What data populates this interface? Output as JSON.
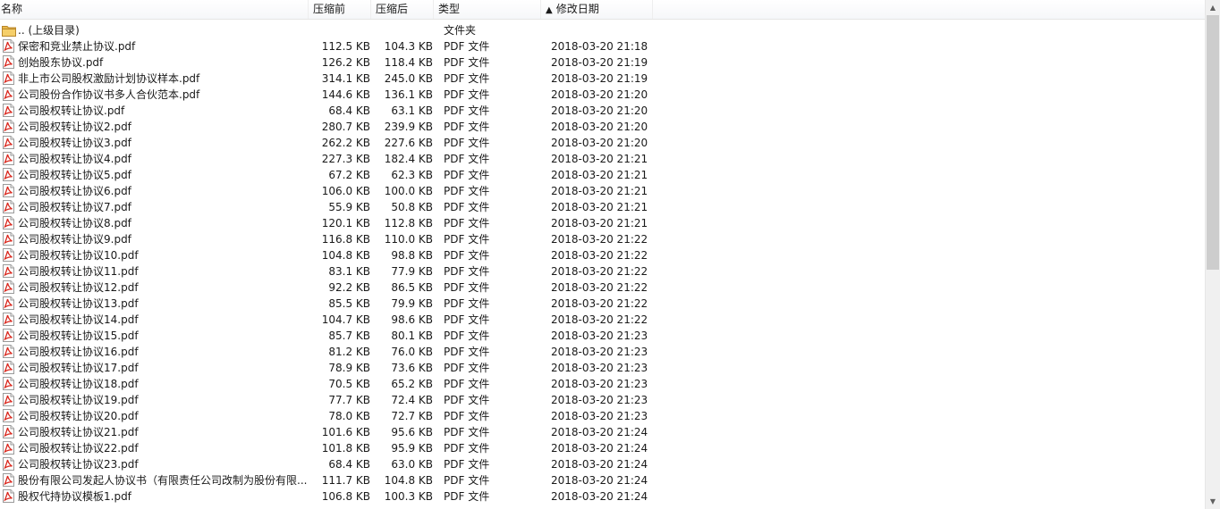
{
  "columns": {
    "name": "名称",
    "size_before": "压缩前",
    "size_after": "压缩后",
    "type": "类型",
    "modified": "修改日期",
    "sort_indicator": "▲"
  },
  "parent_row": {
    "name": ".. (上级目录)",
    "type": "文件夹",
    "icon": "folder-icon"
  },
  "files": [
    {
      "name": "保密和竞业禁止协议.pdf",
      "before": "112.5 KB",
      "after": "104.3 KB",
      "type": "PDF 文件",
      "date": "2018-03-20 21:18"
    },
    {
      "name": "创始股东协议.pdf",
      "before": "126.2 KB",
      "after": "118.4 KB",
      "type": "PDF 文件",
      "date": "2018-03-20 21:19"
    },
    {
      "name": "非上市公司股权激励计划协议样本.pdf",
      "before": "314.1 KB",
      "after": "245.0 KB",
      "type": "PDF 文件",
      "date": "2018-03-20 21:19"
    },
    {
      "name": "公司股份合作协议书多人合伙范本.pdf",
      "before": "144.6 KB",
      "after": "136.1 KB",
      "type": "PDF 文件",
      "date": "2018-03-20 21:20"
    },
    {
      "name": "公司股权转让协议.pdf",
      "before": "68.4 KB",
      "after": "63.1 KB",
      "type": "PDF 文件",
      "date": "2018-03-20 21:20"
    },
    {
      "name": "公司股权转让协议2.pdf",
      "before": "280.7 KB",
      "after": "239.9 KB",
      "type": "PDF 文件",
      "date": "2018-03-20 21:20"
    },
    {
      "name": "公司股权转让协议3.pdf",
      "before": "262.2 KB",
      "after": "227.6 KB",
      "type": "PDF 文件",
      "date": "2018-03-20 21:20"
    },
    {
      "name": "公司股权转让协议4.pdf",
      "before": "227.3 KB",
      "after": "182.4 KB",
      "type": "PDF 文件",
      "date": "2018-03-20 21:21"
    },
    {
      "name": "公司股权转让协议5.pdf",
      "before": "67.2 KB",
      "after": "62.3 KB",
      "type": "PDF 文件",
      "date": "2018-03-20 21:21"
    },
    {
      "name": "公司股权转让协议6.pdf",
      "before": "106.0 KB",
      "after": "100.0 KB",
      "type": "PDF 文件",
      "date": "2018-03-20 21:21"
    },
    {
      "name": "公司股权转让协议7.pdf",
      "before": "55.9 KB",
      "after": "50.8 KB",
      "type": "PDF 文件",
      "date": "2018-03-20 21:21"
    },
    {
      "name": "公司股权转让协议8.pdf",
      "before": "120.1 KB",
      "after": "112.8 KB",
      "type": "PDF 文件",
      "date": "2018-03-20 21:21"
    },
    {
      "name": "公司股权转让协议9.pdf",
      "before": "116.8 KB",
      "after": "110.0 KB",
      "type": "PDF 文件",
      "date": "2018-03-20 21:22"
    },
    {
      "name": "公司股权转让协议10.pdf",
      "before": "104.8 KB",
      "after": "98.8 KB",
      "type": "PDF 文件",
      "date": "2018-03-20 21:22"
    },
    {
      "name": "公司股权转让协议11.pdf",
      "before": "83.1 KB",
      "after": "77.9 KB",
      "type": "PDF 文件",
      "date": "2018-03-20 21:22"
    },
    {
      "name": "公司股权转让协议12.pdf",
      "before": "92.2 KB",
      "after": "86.5 KB",
      "type": "PDF 文件",
      "date": "2018-03-20 21:22"
    },
    {
      "name": "公司股权转让协议13.pdf",
      "before": "85.5 KB",
      "after": "79.9 KB",
      "type": "PDF 文件",
      "date": "2018-03-20 21:22"
    },
    {
      "name": "公司股权转让协议14.pdf",
      "before": "104.7 KB",
      "after": "98.6 KB",
      "type": "PDF 文件",
      "date": "2018-03-20 21:22"
    },
    {
      "name": "公司股权转让协议15.pdf",
      "before": "85.7 KB",
      "after": "80.1 KB",
      "type": "PDF 文件",
      "date": "2018-03-20 21:23"
    },
    {
      "name": "公司股权转让协议16.pdf",
      "before": "81.2 KB",
      "after": "76.0 KB",
      "type": "PDF 文件",
      "date": "2018-03-20 21:23"
    },
    {
      "name": "公司股权转让协议17.pdf",
      "before": "78.9 KB",
      "after": "73.6 KB",
      "type": "PDF 文件",
      "date": "2018-03-20 21:23"
    },
    {
      "name": "公司股权转让协议18.pdf",
      "before": "70.5 KB",
      "after": "65.2 KB",
      "type": "PDF 文件",
      "date": "2018-03-20 21:23"
    },
    {
      "name": "公司股权转让协议19.pdf",
      "before": "77.7 KB",
      "after": "72.4 KB",
      "type": "PDF 文件",
      "date": "2018-03-20 21:23"
    },
    {
      "name": "公司股权转让协议20.pdf",
      "before": "78.0 KB",
      "after": "72.7 KB",
      "type": "PDF 文件",
      "date": "2018-03-20 21:23"
    },
    {
      "name": "公司股权转让协议21.pdf",
      "before": "101.6 KB",
      "after": "95.6 KB",
      "type": "PDF 文件",
      "date": "2018-03-20 21:24"
    },
    {
      "name": "公司股权转让协议22.pdf",
      "before": "101.8 KB",
      "after": "95.9 KB",
      "type": "PDF 文件",
      "date": "2018-03-20 21:24"
    },
    {
      "name": "公司股权转让协议23.pdf",
      "before": "68.4 KB",
      "after": "63.0 KB",
      "type": "PDF 文件",
      "date": "2018-03-20 21:24"
    },
    {
      "name": "股份有限公司发起人协议书（有限责任公司改制为股份有限...",
      "before": "111.7 KB",
      "after": "104.8 KB",
      "type": "PDF 文件",
      "date": "2018-03-20 21:24"
    },
    {
      "name": "股权代持协议模板1.pdf",
      "before": "106.8 KB",
      "after": "100.3 KB",
      "type": "PDF 文件",
      "date": "2018-03-20 21:24"
    }
  ],
  "icons": {
    "file": "pdf-file-icon",
    "folder": "folder-icon",
    "scroll_up": "scroll-up-arrow-icon",
    "scroll_down": "scroll-down-arrow-icon"
  },
  "colors": {
    "pdf_red": "#d9261c",
    "folder_yellow": "#e8b84a",
    "scroll_thumb": "#cdcdcd"
  }
}
